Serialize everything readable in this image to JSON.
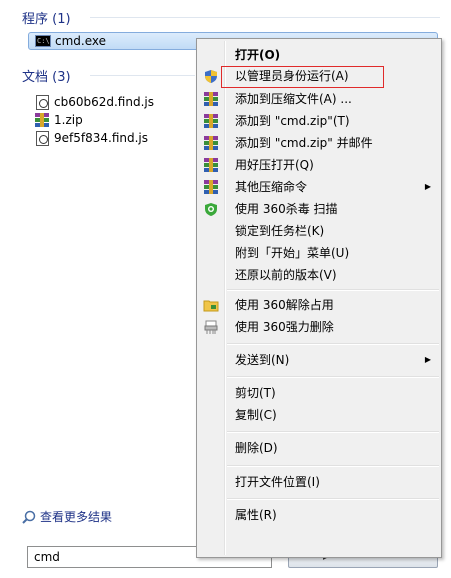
{
  "programs": {
    "title": "程序 (1)",
    "items": [
      {
        "label": "cmd.exe",
        "icon": "cmd-icon"
      }
    ]
  },
  "documents": {
    "title": "文档 (3)",
    "items": [
      {
        "label": "cb60b62d.find.js",
        "icon": "js-file-icon"
      },
      {
        "label": "1.zip",
        "icon": "zip-icon"
      },
      {
        "label": "9ef5f834.find.js",
        "icon": "js-file-icon"
      }
    ]
  },
  "more_results": "查看更多结果",
  "search": {
    "value": "cmd"
  },
  "context_menu": {
    "items": [
      {
        "label": "打开(O)",
        "bold": true
      },
      {
        "label": "以管理员身份运行(A)",
        "icon": "shield-icon",
        "highlighted": true
      },
      {
        "label": "添加到压缩文件(A) ...",
        "icon": "zip-icon"
      },
      {
        "label": "添加到 \"cmd.zip\"(T)",
        "icon": "zip-icon"
      },
      {
        "label": "添加到 \"cmd.zip\" 并邮件",
        "icon": "zip-icon"
      },
      {
        "label": "用好压打开(Q)",
        "icon": "zip-icon"
      },
      {
        "label": "其他压缩命令",
        "icon": "zip-icon",
        "submenu": true
      },
      {
        "label": "使用 360杀毒 扫描",
        "icon": "360-shield-icon"
      },
      {
        "label": "锁定到任务栏(K)"
      },
      {
        "label": "附到「开始」菜单(U)"
      },
      {
        "label": "还原以前的版本(V)"
      },
      {
        "label": "使用 360解除占用",
        "icon": "unlock-folder-icon"
      },
      {
        "label": "使用 360强力删除",
        "icon": "shredder-icon"
      },
      {
        "label": "发送到(N)",
        "submenu": true
      },
      {
        "label": "剪切(T)"
      },
      {
        "label": "复制(C)"
      },
      {
        "label": "删除(D)"
      },
      {
        "label": "打开文件位置(I)"
      },
      {
        "label": "属性(R)"
      }
    ]
  },
  "colors": {
    "section_title": "#1e3287",
    "highlight_border": "#e02a2a",
    "menu_bg": "#f0f0f0"
  }
}
